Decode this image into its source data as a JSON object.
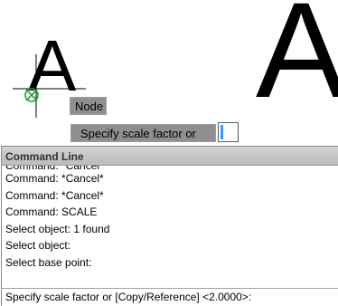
{
  "drawing": {
    "big_letter": "A",
    "small_letter": "A",
    "osnap_marker": "node-snap-marker",
    "crosshair": "crosshair-cursor"
  },
  "tooltip": {
    "snap_label": "Node",
    "prompt_label": "Specify scale factor or"
  },
  "command_line": {
    "title": "Command Line",
    "history": [
      "Command: *Cancel*",
      "Command: *Cancel*",
      "Command: *Cancel*",
      "Command: SCALE",
      "Select object: 1 found",
      "Select object:",
      "Select base point:"
    ],
    "current_prompt": "Specify scale factor or [Copy/Reference] <2.0000>:"
  }
}
